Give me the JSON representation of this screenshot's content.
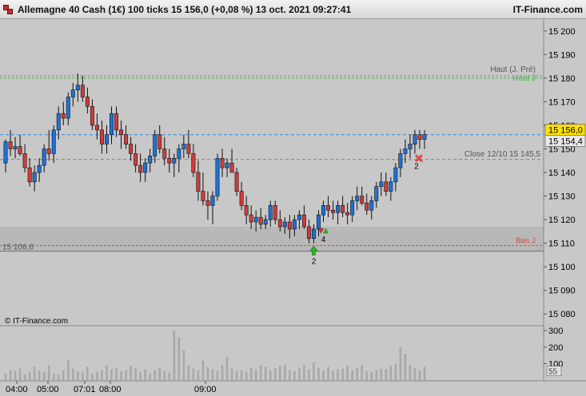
{
  "header": {
    "title": "Allemagne 40 Cash (1€) 100 ticks 15 156,0 (+0,08 %) 13 oct. 2021 09:27:41",
    "brand": "IT-Finance.com"
  },
  "watermark": "© IT-Finance.com",
  "colors": {
    "up": "#1e73d8",
    "down": "#d23c3c",
    "haut": "#48b848",
    "bas": "#d05050",
    "last": "#2a8ae0",
    "close": "#808080",
    "zone": "#b8b8b8",
    "background": "#c8c8c8"
  },
  "chart_data": [
    {
      "type": "candlestick",
      "price_axis": {
        "ticks": [
          "15 200",
          "15 190",
          "15 180",
          "15 170",
          "15 160",
          "15 150",
          "15 140",
          "15 130",
          "15 120",
          "15 110",
          "15 100",
          "15 090",
          "15 080"
        ],
        "range": [
          15075,
          15205
        ]
      },
      "time_axis": {
        "labels": [
          "04:00",
          "05:00",
          "07:01",
          "08:00",
          "09:00"
        ]
      },
      "levels": {
        "haut": {
          "label": "Haut (J. Pré)",
          "value": 15181
        },
        "haut_green": {
          "label": "Haut J",
          "value": 15180
        },
        "last": {
          "label": "15 156,0",
          "value": 15156
        },
        "last2": {
          "label": "15 154,4",
          "value": 15154.4
        },
        "close": {
          "label": "Close 12/10 15 145,5",
          "value": 15145.5
        },
        "bas": {
          "label": "Bas J",
          "value": 15109
        },
        "low_left": {
          "label": "15 106,6",
          "value": 15106.6
        }
      },
      "zone": [
        15106.6,
        15117
      ],
      "signals": [
        {
          "bar": 64,
          "label": "2",
          "kind": "buy"
        },
        {
          "bar": 66,
          "label": "4",
          "kind": "mixed"
        },
        {
          "bar": 85,
          "label": "2",
          "kind": "sell"
        }
      ],
      "candles": [
        [
          15144,
          15154,
          15140,
          15153
        ],
        [
          15153,
          15158,
          15147,
          15150
        ],
        [
          15150,
          15155,
          15146,
          15151
        ],
        [
          15151,
          15156,
          15147,
          15148
        ],
        [
          15148,
          15152,
          15140,
          15142
        ],
        [
          15142,
          15146,
          15134,
          15136
        ],
        [
          15136,
          15143,
          15132,
          15140
        ],
        [
          15140,
          15146,
          15136,
          15143
        ],
        [
          15143,
          15152,
          15140,
          15150
        ],
        [
          15150,
          15158,
          15145,
          15148
        ],
        [
          15148,
          15160,
          15144,
          15158
        ],
        [
          15158,
          15168,
          15154,
          15165
        ],
        [
          15165,
          15170,
          15160,
          15163
        ],
        [
          15163,
          15174,
          15160,
          15172
        ],
        [
          15172,
          15178,
          15168,
          15175
        ],
        [
          15175,
          15182,
          15170,
          15177
        ],
        [
          15177,
          15181,
          15170,
          15172
        ],
        [
          15172,
          15176,
          15165,
          15168
        ],
        [
          15168,
          15171,
          15158,
          15160
        ],
        [
          15160,
          15165,
          15154,
          15158
        ],
        [
          15158,
          15162,
          15148,
          15152
        ],
        [
          15152,
          15160,
          15148,
          15156
        ],
        [
          15156,
          15168,
          15152,
          15165
        ],
        [
          15165,
          15168,
          15155,
          15158
        ],
        [
          15158,
          15162,
          15150,
          15156
        ],
        [
          15156,
          15160,
          15150,
          15152
        ],
        [
          15152,
          15155,
          15145,
          15148
        ],
        [
          15148,
          15152,
          15140,
          15143
        ],
        [
          15143,
          15148,
          15136,
          15140
        ],
        [
          15140,
          15146,
          15136,
          15144
        ],
        [
          15144,
          15150,
          15140,
          15147
        ],
        [
          15147,
          15158,
          15144,
          15156
        ],
        [
          15156,
          15160,
          15148,
          15150
        ],
        [
          15150,
          15155,
          15143,
          15146
        ],
        [
          15146,
          15150,
          15140,
          15144
        ],
        [
          15144,
          15148,
          15138,
          15146
        ],
        [
          15146,
          15152,
          15140,
          15150
        ],
        [
          15150,
          15156,
          15146,
          15152
        ],
        [
          15152,
          15158,
          15146,
          15148
        ],
        [
          15148,
          15152,
          15138,
          15140
        ],
        [
          15140,
          15145,
          15128,
          15132
        ],
        [
          15132,
          15140,
          15126,
          15128
        ],
        [
          15128,
          15132,
          15120,
          15126
        ],
        [
          15126,
          15132,
          15118,
          15130
        ],
        [
          15130,
          15148,
          15128,
          15146
        ],
        [
          15146,
          15150,
          15138,
          15142
        ],
        [
          15142,
          15146,
          15138,
          15144
        ],
        [
          15144,
          15150,
          15140,
          15140
        ],
        [
          15140,
          15142,
          15130,
          15132
        ],
        [
          15132,
          15136,
          15124,
          15126
        ],
        [
          15126,
          15130,
          15118,
          15122
        ],
        [
          15122,
          15126,
          15116,
          15119
        ],
        [
          15119,
          15124,
          15115,
          15121
        ],
        [
          15121,
          15125,
          15116,
          15118
        ],
        [
          15118,
          15122,
          15116,
          15120
        ],
        [
          15120,
          15128,
          15117,
          15126
        ],
        [
          15126,
          15128,
          15118,
          15120
        ],
        [
          15120,
          15124,
          15115,
          15117
        ],
        [
          15117,
          15121,
          15114,
          15119
        ],
        [
          15119,
          15122,
          15112,
          15116
        ],
        [
          15116,
          15122,
          15113,
          15120
        ],
        [
          15120,
          15124,
          15116,
          15122
        ],
        [
          15122,
          15126,
          15116,
          15117
        ],
        [
          15117,
          15120,
          15110,
          15112
        ],
        [
          15112,
          15118,
          15110,
          15116
        ],
        [
          15116,
          15124,
          15113,
          15122
        ],
        [
          15122,
          15128,
          15119,
          15126
        ],
        [
          15126,
          15130,
          15121,
          15124
        ],
        [
          15124,
          15128,
          15120,
          15123
        ],
        [
          15123,
          15128,
          15118,
          15126
        ],
        [
          15126,
          15130,
          15121,
          15123
        ],
        [
          15123,
          15127,
          15118,
          15122
        ],
        [
          15122,
          15130,
          15119,
          15128
        ],
        [
          15128,
          15134,
          15124,
          15130
        ],
        [
          15130,
          15134,
          15126,
          15127
        ],
        [
          15127,
          15131,
          15122,
          15124
        ],
        [
          15124,
          15130,
          15120,
          15128
        ],
        [
          15128,
          15136,
          15125,
          15134
        ],
        [
          15134,
          15140,
          15130,
          15136
        ],
        [
          15136,
          15140,
          15130,
          15132
        ],
        [
          15132,
          15138,
          15128,
          15136
        ],
        [
          15136,
          15144,
          15132,
          15142
        ],
        [
          15142,
          15150,
          15138,
          15148
        ],
        [
          15148,
          15154,
          15144,
          15150
        ],
        [
          15150,
          15156,
          15146,
          15152
        ],
        [
          15152,
          15158,
          15148,
          15156
        ],
        [
          15156,
          15158,
          15150,
          15154
        ],
        [
          15154,
          15158,
          15150,
          15156
        ]
      ],
      "volume": {
        "ticks": [
          "300",
          "200",
          "100",
          "55"
        ],
        "values": [
          40,
          60,
          55,
          70,
          35,
          45,
          80,
          60,
          50,
          90,
          40,
          35,
          60,
          120,
          70,
          55,
          45,
          80,
          40,
          50,
          60,
          90,
          65,
          75,
          55,
          60,
          85,
          70,
          50,
          65,
          40,
          60,
          75,
          55,
          45,
          300,
          260,
          180,
          90,
          70,
          60,
          120,
          80,
          65,
          55,
          90,
          140,
          70,
          55,
          60,
          50,
          75,
          65,
          90,
          80,
          60,
          70,
          85,
          95,
          60,
          55,
          70,
          90,
          65,
          110,
          75,
          60,
          80,
          55,
          65,
          70,
          85,
          60,
          75,
          90,
          55,
          50,
          60,
          70,
          65,
          85,
          100,
          200,
          160,
          90,
          70,
          60,
          80
        ]
      }
    }
  ]
}
